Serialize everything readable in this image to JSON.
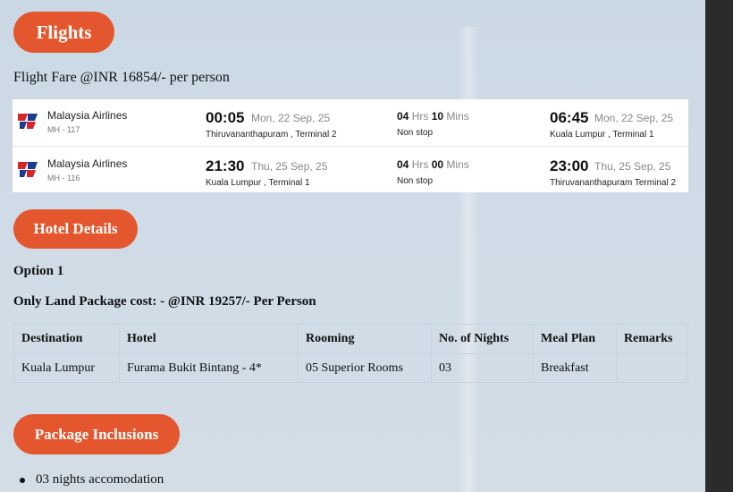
{
  "sections": {
    "flights": "Flights",
    "hotel": "Hotel Details",
    "inclusions": "Package Inclusions"
  },
  "fare_text": "Flight Fare @INR 16854/- per person",
  "flights": [
    {
      "airline": "Malaysia Airlines",
      "code": "MH - 117",
      "dep_time": "00:05",
      "dep_date": "Mon, 22 Sep, 25",
      "dep_place": "Thiruvananthapuram , Terminal 2",
      "dur_h": "04",
      "dur_h_unit": "Hrs",
      "dur_m": "10",
      "dur_m_unit": "Mins",
      "stops": "Non stop",
      "arr_time": "06:45",
      "arr_date": "Mon, 22 Sep, 25",
      "arr_place": "Kuala Lumpur , Terminal 1"
    },
    {
      "airline": "Malaysia Airlines",
      "code": "MH - 116",
      "dep_time": "21:30",
      "dep_date": "Thu, 25 Sep, 25",
      "dep_place": "Kuala Lumpur , Terminal 1",
      "dur_h": "04",
      "dur_h_unit": "Hrs",
      "dur_m": "00",
      "dur_m_unit": "Mins",
      "stops": "Non stop",
      "arr_time": "23:00",
      "arr_date": "Thu, 25 Sep, 25",
      "arr_place": "Thiruvananthapuram Terminal 2"
    }
  ],
  "option": "Option 1",
  "land_cost": "Only Land Package cost: - @INR 19257/- Per Person",
  "hotel_table": {
    "headers": [
      "Destination",
      "Hotel",
      "Rooming",
      "No. of Nights",
      "Meal Plan",
      "Remarks"
    ],
    "row": [
      "Kuala Lumpur",
      "Furama Bukit Bintang - 4*",
      "05 Superior Rooms",
      "03",
      "Breakfast",
      ""
    ]
  },
  "inclusions": [
    "03 nights accomodation"
  ],
  "colors": {
    "accent": "#e4572e",
    "logo_red": "#d7262a",
    "logo_blue": "#1b3d8f"
  }
}
